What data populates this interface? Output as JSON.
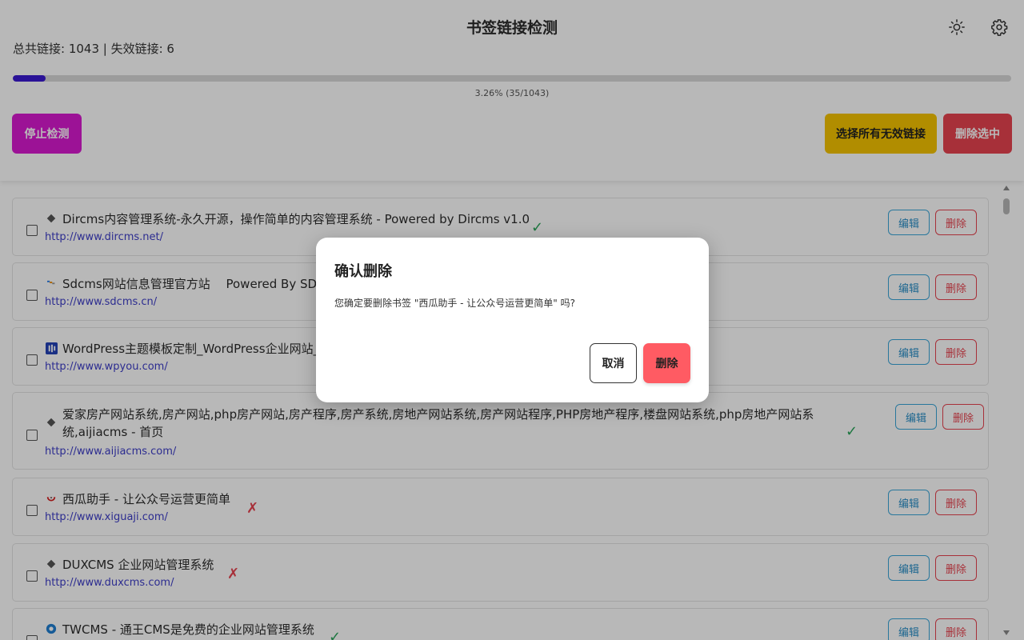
{
  "app": {
    "title": "书签链接检测",
    "stats": "总共链接: 1043 | 失效链接: 6",
    "progress_text": "3.26% (35/1043)",
    "progress_fraction": 0.0326,
    "theme_icon": "sun-icon",
    "settings_icon": "gear-icon"
  },
  "toolbar": {
    "stop_label": "停止检测",
    "select_invalid_label": "选择所有无效链接",
    "delete_selected_label": "删除选中"
  },
  "bookmarks": [
    {
      "title": "Dircms内容管理系统-永久开源，操作简单的内容管理系统 - Powered by Dircms v1.0",
      "url": "http://www.dircms.net/",
      "status": "✓",
      "favicon": "diamond-icon",
      "edit": "编辑",
      "delete": "删除"
    },
    {
      "title": "Sdcms网站信息管理官方站　 Powered By SDCMS",
      "url": "http://www.sdcms.cn/",
      "status": "",
      "favicon": "sdcms-icon",
      "edit": "编辑",
      "delete": "删除"
    },
    {
      "title": "WordPress主题模板定制_WordPress企业网站_WPYOU",
      "url": "http://www.wpyou.com/",
      "status": "",
      "favicon": "wpyou-icon",
      "edit": "编辑",
      "delete": "删除"
    },
    {
      "title": "爱家房产网站系统,房产网站,php房产网站,房产程序,房产系统,房地产网站系统,房产网站程序,PHP房地产程序,楼盘网站系统,php房地产网站系统,aijiacms - 首页",
      "url": "http://www.aijiacms.com/",
      "status": "✓",
      "favicon": "diamond-icon",
      "edit": "编辑",
      "delete": "删除"
    },
    {
      "title": "西瓜助手 - 让公众号运营更简单",
      "url": "http://www.xiguaji.com/",
      "status": "✗",
      "favicon": "xigua-icon",
      "edit": "编辑",
      "delete": "删除"
    },
    {
      "title": "DUXCMS 企业网站管理系统",
      "url": "http://www.duxcms.com/",
      "status": "✗",
      "favicon": "diamond-icon",
      "edit": "编辑",
      "delete": "删除"
    },
    {
      "title": "TWCMS - 通王CMS是免费的企业网站管理系统",
      "url": "",
      "status": "✓",
      "favicon": "twcms-icon",
      "edit": "编辑",
      "delete": "删除"
    }
  ],
  "dialog": {
    "title": "确认删除",
    "message": "您确定要删除书签 \"西瓜助手 - 让公众号运营更简单\" 吗?",
    "cancel_label": "取消",
    "confirm_label": "删除"
  },
  "colors": {
    "progress": "#3b1ad1",
    "stop_button": "#d91ad0",
    "select_invalid_button": "#f5c400",
    "delete_button": "#e8434f",
    "ok": "#2aa55a",
    "bad": "#e8434f",
    "link": "#3d3dc8"
  }
}
